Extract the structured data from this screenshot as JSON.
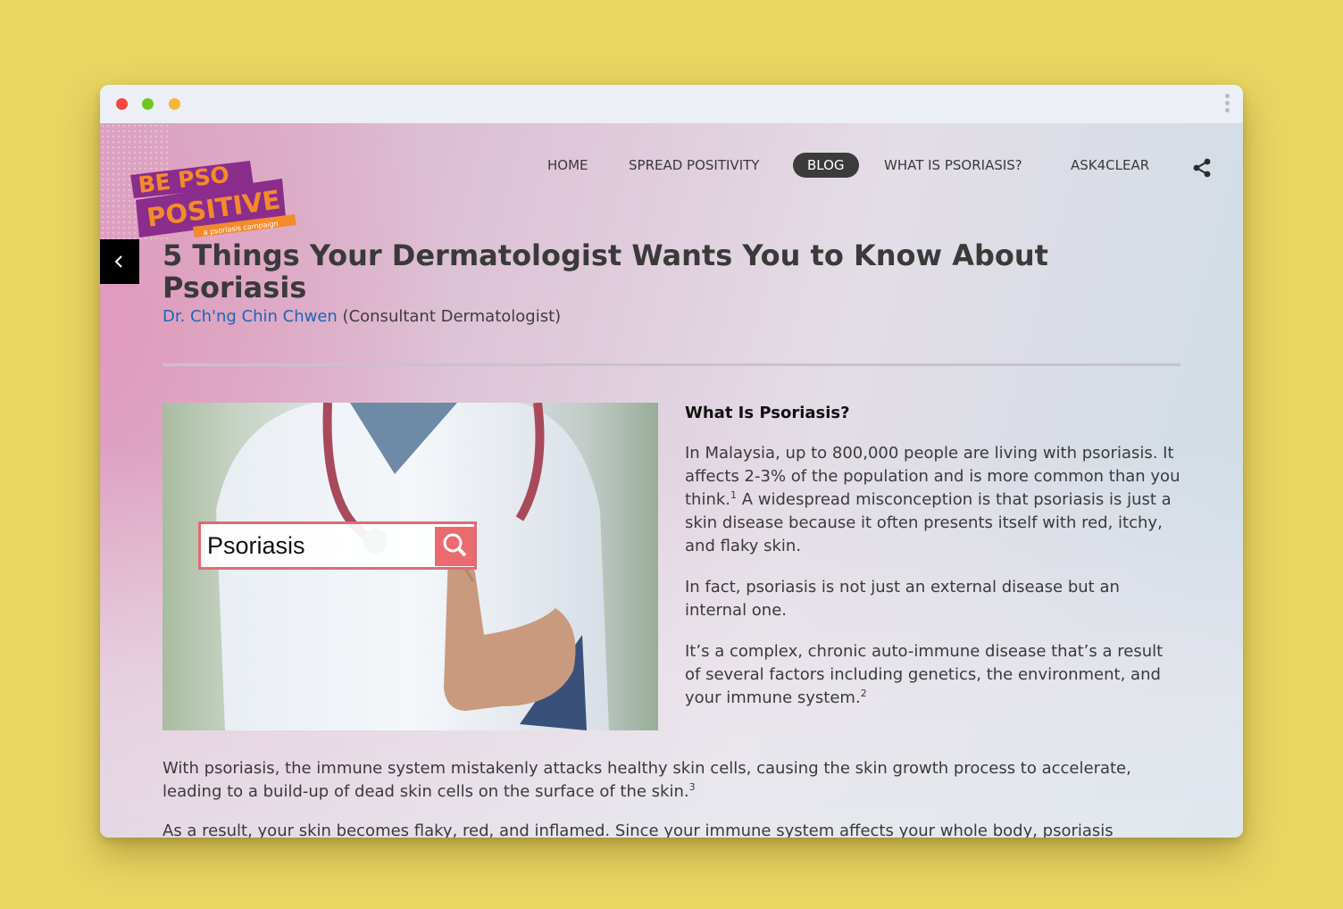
{
  "window": {
    "title_dots": [
      "close",
      "minimize",
      "maximize"
    ]
  },
  "logo": {
    "line1": "BE PSO",
    "line2": "POSITIVE",
    "tagline": "a psoriasis campaign"
  },
  "nav": {
    "items": [
      {
        "label": "HOME",
        "active": false
      },
      {
        "label": "SPREAD POSITIVITY",
        "active": false
      },
      {
        "label": "BLOG",
        "active": true
      },
      {
        "label": "WHAT IS PSORIASIS?",
        "active": false
      },
      {
        "label": "ASK4CLEAR",
        "active": false
      }
    ],
    "share_icon": "share-icon"
  },
  "article": {
    "title": "5 Things Your Dermatologist Wants You to Know About Psoriasis",
    "author_name": "Dr. Ch'ng Chin Chwen",
    "author_role": " (Consultant Dermatologist)",
    "hero_search_text": "Psoriasis",
    "section_heading": "What Is Psoriasis?",
    "p1_a": "In Malaysia, up to 800,000 people are living with psoriasis. It affects 2-3% of the population and is more common than you think.",
    "p1_sup": "1",
    "p1_b": " A widespread misconception is that psoriasis is just a skin disease because it often presents itself with red, itchy, and flaky skin.",
    "p2": "In fact, psoriasis is not just an external disease but an internal one.",
    "p3_a": "It’s a complex, chronic auto-immune disease that’s a result of several factors including genetics, the environment, and your immune system.",
    "p3_sup": "2",
    "p4_a": "With psoriasis, the immune system mistakenly attacks healthy skin cells, causing the skin growth process to accelerate, leading to a build-up of dead skin cells on the surface of the skin.",
    "p4_sup": "3",
    "p5": "As a result, your skin becomes flaky, red, and inflamed. Since your immune system affects your whole body, psoriasis"
  },
  "colors": {
    "page_bg": "#e8d562",
    "nav_active_bg": "#3b3b3b",
    "author_link": "#1a66b8",
    "logo_orange": "#f58a2b",
    "logo_purple": "#8b2d8c"
  }
}
